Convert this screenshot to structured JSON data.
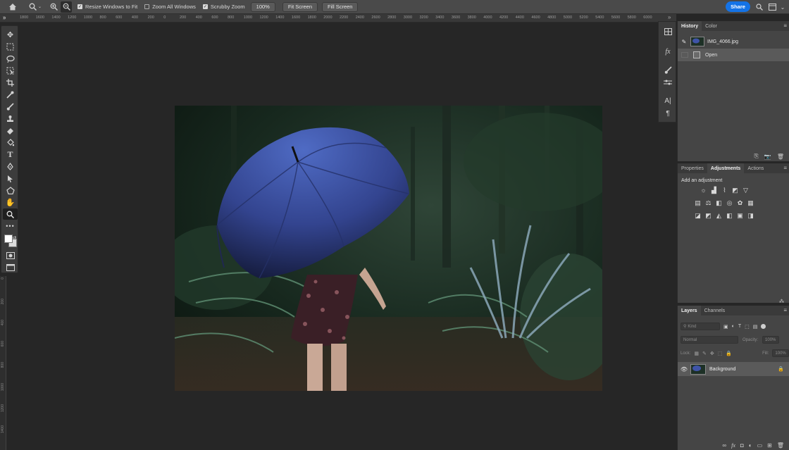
{
  "options_bar": {
    "home_icon": "home-icon",
    "zoom_icon": "zoom-tool-icon",
    "resize_windows_to_fit": {
      "label": "Resize Windows to Fit",
      "checked": true
    },
    "zoom_all_windows": {
      "label": "Zoom All Windows",
      "checked": false
    },
    "scrubby_zoom": {
      "label": "Scrubby Zoom",
      "checked": true
    },
    "zoom_percent": "100%",
    "fit_screen": "Fit Screen",
    "fill_screen": "Fill Screen",
    "share_label": "Share",
    "chevron": "»"
  },
  "ruler": {
    "ticks": [
      "1800",
      "1600",
      "1400",
      "1200",
      "1000",
      "800",
      "600",
      "400",
      "200",
      "0",
      "200",
      "400",
      "600",
      "800",
      "1000",
      "1200",
      "1400",
      "1600",
      "1800",
      "2000",
      "2200",
      "2400",
      "2600",
      "2800",
      "3000",
      "3200",
      "3400",
      "3600",
      "3800",
      "4000",
      "4200",
      "4400",
      "4600",
      "4800",
      "5000",
      "5200",
      "5400",
      "5600",
      "5800",
      "6000"
    ],
    "vertical_ticks": [
      "0",
      "200",
      "400",
      "600",
      "800",
      "1000",
      "1200",
      "1400"
    ]
  },
  "history_panel": {
    "tabs": [
      "History",
      "Color"
    ],
    "active_tab": "History",
    "snapshot": "IMG_4066.jpg",
    "steps": [
      "Open"
    ]
  },
  "adjustments_panel": {
    "tabs": [
      "Properties",
      "Adjustments",
      "Actions"
    ],
    "active_tab": "Adjustments",
    "title": "Add an adjustment"
  },
  "layers_panel": {
    "tabs": [
      "Layers",
      "Channels"
    ],
    "active_tab": "Layers",
    "kind_placeholder": "Kind",
    "blend_mode": "Normal",
    "opacity_label": "Opacity:",
    "opacity_value": "100%",
    "lock_label": "Lock:",
    "fill_label": "Fill:",
    "fill_value": "100%",
    "layers": [
      {
        "name": "Background",
        "visible": true,
        "locked": true
      }
    ]
  },
  "colors": {
    "accent": "#1473e6",
    "foreground_swatch": "#ffffff",
    "background_swatch": "#dcdcdc"
  }
}
